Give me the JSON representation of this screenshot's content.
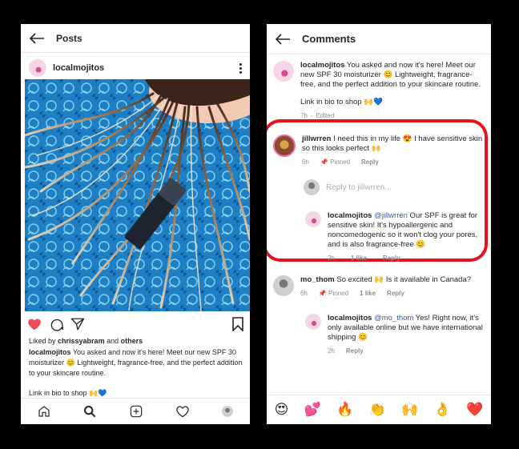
{
  "left": {
    "header_title": "Posts",
    "username": "localmojitos",
    "liked_by_prefix": "Liked by ",
    "liked_by_user": "chrissyabram",
    "liked_by_and": " and ",
    "liked_by_others": "others",
    "caption_user": "localmojitos",
    "caption_text": " You asked and now it's here! Meet our new SPF 30 moisturizer 😊 Lightweight, fragrance-free, and the perfect addition to your skincare routine.",
    "caption_link": "Link in bio to shop 🙌💙"
  },
  "right": {
    "header_title": "Comments",
    "original": {
      "user": "localmojitos",
      "text": " You asked and now it's here! Meet our new SPF 30 moisturizer 😊 Lightweight, fragrance-free, and the perfect addition to your skincare routine.",
      "link": "Link in bio to shop 🙌💙",
      "time": "7h",
      "sep": "·",
      "edited": "Edited"
    },
    "comment1": {
      "user": "jillwrren",
      "text": " I need this in my life 😍 I have sensitive skin so this looks perfect 🙌",
      "time": "6h",
      "pinned": "Pinned",
      "reply": "Reply",
      "reply_placeholder": "Reply to jillwrren..."
    },
    "reply1": {
      "user": "localmojitos",
      "mention": "@jillwrren",
      "text": " Our SPF is great for sensitive skin! It's hypoallergenic and noncomedogenic so it won't clog your pores, and is also fragrance-free 😊",
      "time": "2h",
      "likes": "1 like",
      "reply": "Reply"
    },
    "comment2": {
      "user": "mo_thom",
      "text": " So excited 🙌 Is it available in Canada?",
      "time": "6h",
      "pinned": "Pinned",
      "likes": "1 like",
      "reply": "Reply"
    },
    "reply2": {
      "user": "localmojitos",
      "mention": "@mo_thom",
      "text": " Yes! Right now, it's only available online but we have international shipping 😊",
      "time": "2h",
      "reply": "Reply"
    },
    "emojis": [
      "😍",
      "💕",
      "🔥",
      "👏",
      "🙌",
      "👌",
      "❤️"
    ]
  },
  "colors": {
    "accent_red": "#e8101c",
    "link_blue": "#3b5998",
    "heart_red": "#ed4956"
  }
}
